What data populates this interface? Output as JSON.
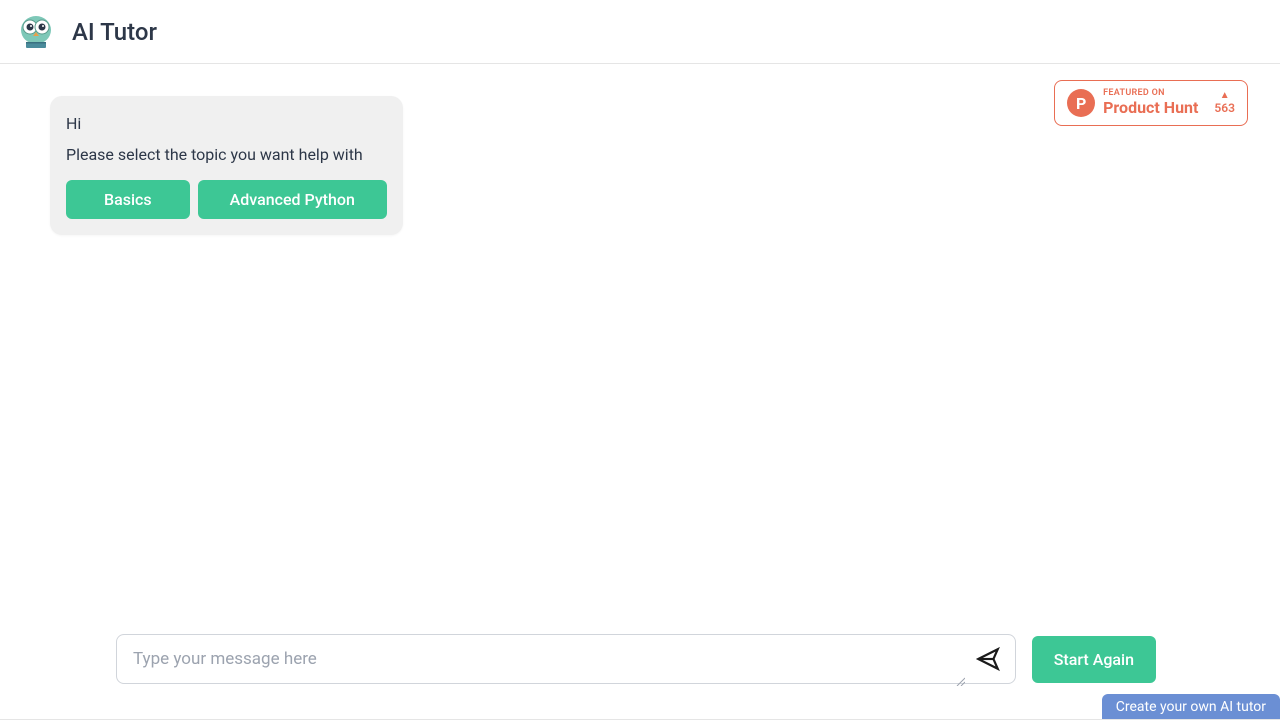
{
  "header": {
    "app_title": "AI Tutor"
  },
  "chat": {
    "greeting": "Hi",
    "prompt": "Please select the topic you want help with",
    "topics": {
      "basics": "Basics",
      "advanced": "Advanced Python"
    }
  },
  "product_hunt": {
    "icon_letter": "P",
    "featured_label": "FEATURED ON",
    "name": "Product Hunt",
    "upvote_count": "563"
  },
  "input": {
    "placeholder": "Type your message here",
    "start_again": "Start Again"
  },
  "cta": {
    "label": "Create your own AI tutor"
  }
}
